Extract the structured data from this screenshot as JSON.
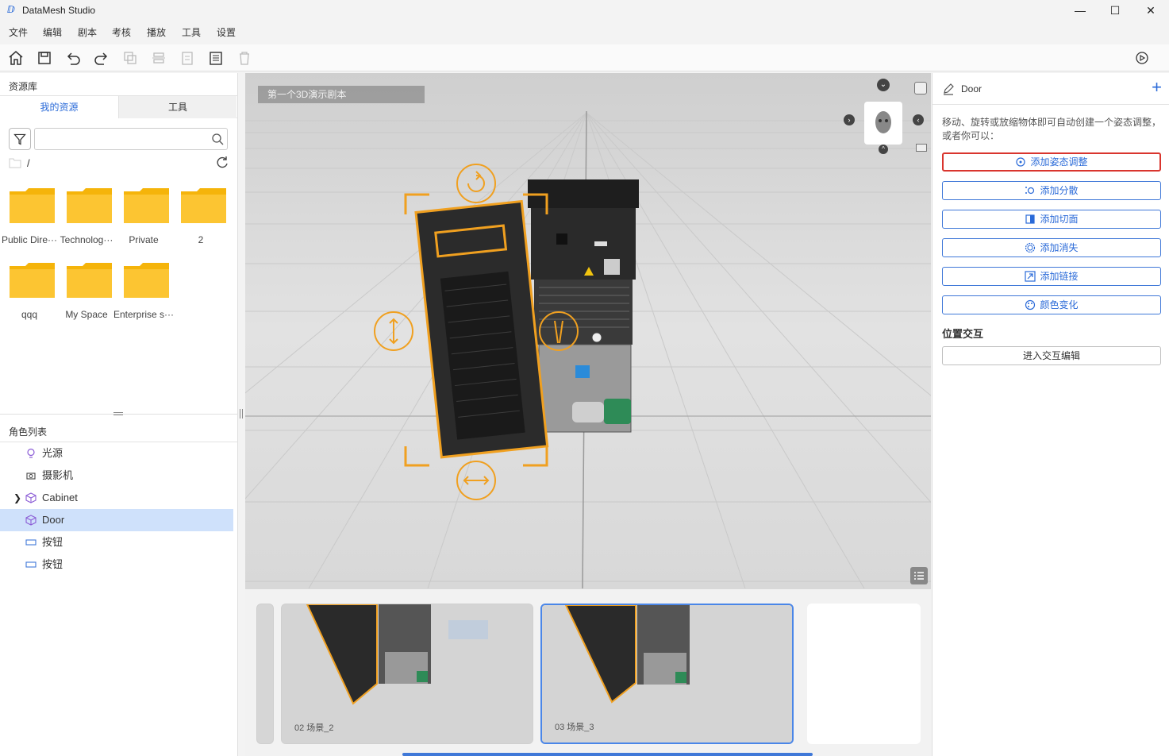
{
  "app": {
    "title": "DataMesh Studio"
  },
  "window": {
    "minimize": "—",
    "maximize": "☐",
    "close": "✕"
  },
  "menu": [
    "文件",
    "编辑",
    "剧本",
    "考核",
    "播放",
    "工具",
    "设置"
  ],
  "toolbar": {
    "icons": [
      "home-icon",
      "save-icon",
      "undo-icon",
      "redo-icon",
      "copy-icon",
      "align-icon",
      "paste-icon",
      "notes-icon",
      "delete-icon",
      "play-icon"
    ]
  },
  "left_panel": {
    "title": "资源库",
    "tabs": [
      {
        "label": "我的资源"
      },
      {
        "label": "工具"
      }
    ],
    "search": {
      "value": "",
      "placeholder": ""
    },
    "path": "/",
    "folders": [
      {
        "label": "Public Dire···"
      },
      {
        "label": "Technolog···"
      },
      {
        "label": "Private"
      },
      {
        "label": "2"
      },
      {
        "label": "qqq"
      },
      {
        "label": "My Space"
      },
      {
        "label": "Enterprise s···"
      }
    ],
    "role_title": "角色列表",
    "roles": [
      {
        "label": "光源",
        "icon": "bulb-icon"
      },
      {
        "label": "摄影机",
        "icon": "camera-icon"
      },
      {
        "label": "Cabinet",
        "icon": "cube-icon"
      },
      {
        "label": "Door",
        "icon": "cube-icon"
      },
      {
        "label": "按钮",
        "icon": "button-icon"
      },
      {
        "label": "按钮",
        "icon": "button-icon"
      }
    ]
  },
  "viewport": {
    "scene_label": "第一个3D演示剧本"
  },
  "timeline": {
    "thumbs": [
      {
        "caption": "02   场景_2"
      },
      {
        "caption": "03   场景_3"
      }
    ]
  },
  "right_panel": {
    "object_name": "Door",
    "description": "移动、旋转或放缩物体即可自动创建一个姿态调整，或者你可以：",
    "buttons": [
      {
        "label": "添加姿态调整"
      },
      {
        "label": "添加分散"
      },
      {
        "label": "添加切面"
      },
      {
        "label": "添加消失"
      },
      {
        "label": "添加链接"
      },
      {
        "label": "颜色变化"
      }
    ],
    "section_title": "位置交互",
    "enter_button": "进入交互编辑"
  },
  "colors": {
    "accent": "#2a6ad8",
    "highlight": "#d9352e",
    "folder": "#f5b40a",
    "selection": "#cfe1fb",
    "gizmo": "#f0a020"
  }
}
